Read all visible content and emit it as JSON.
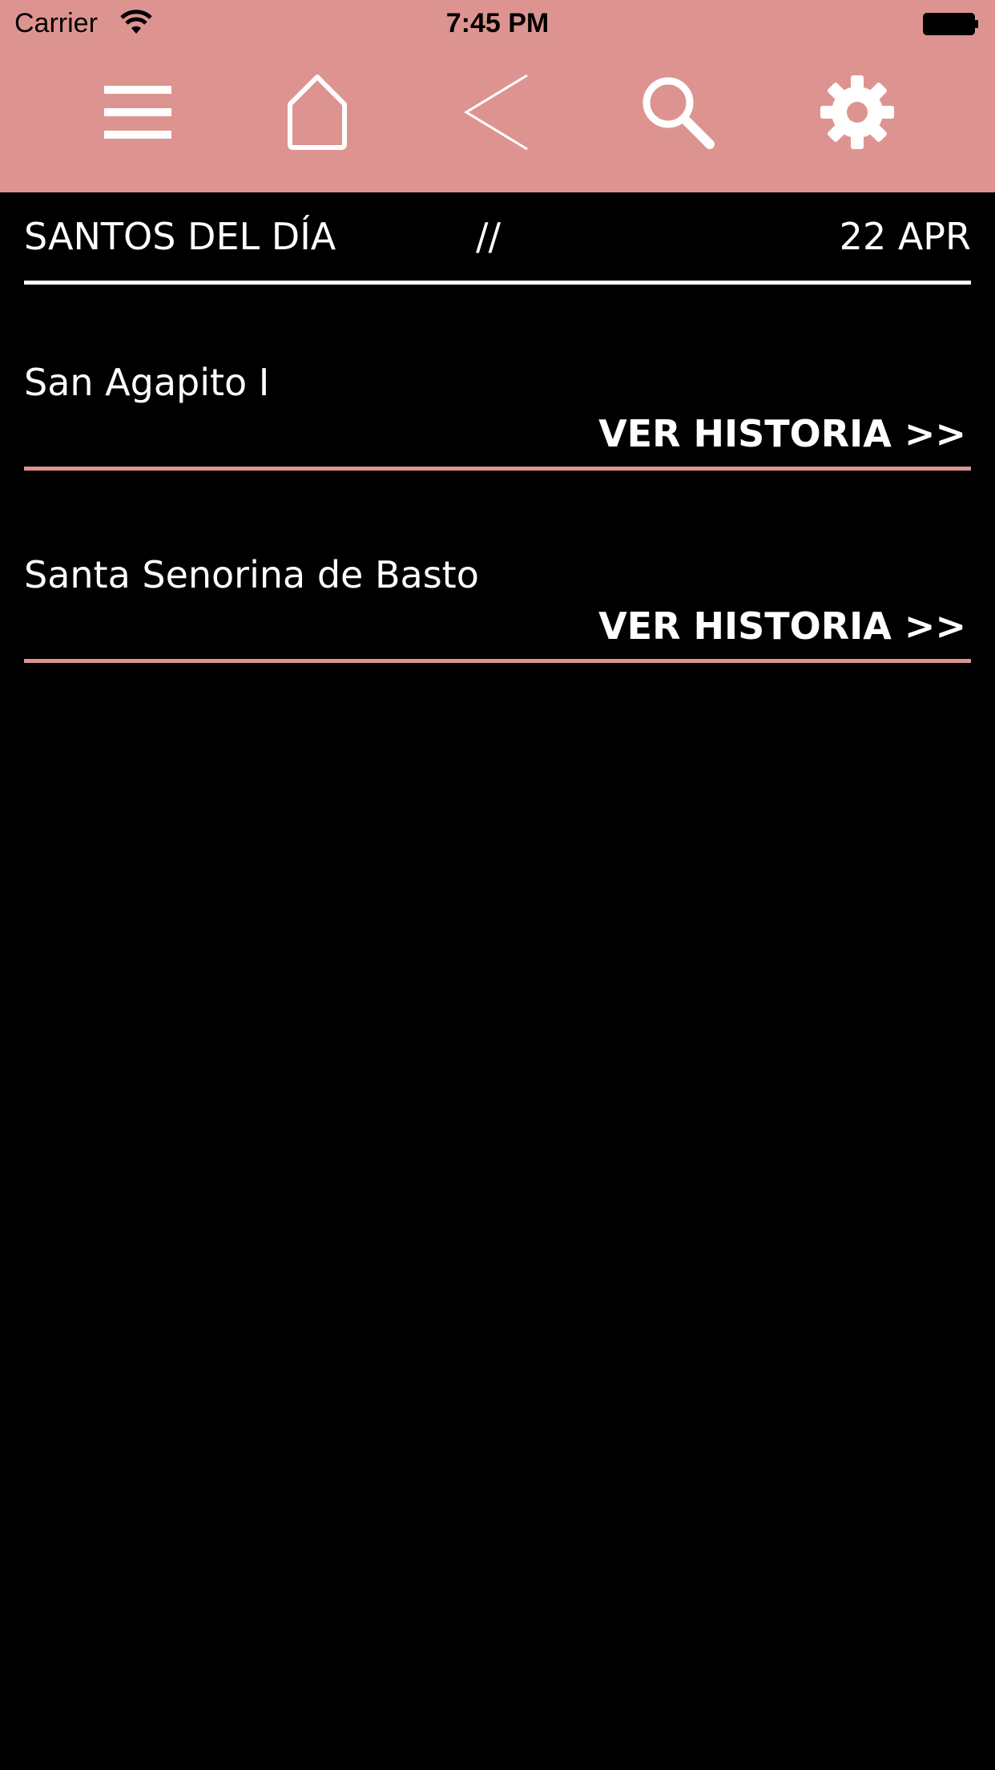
{
  "status_bar": {
    "carrier": "Carrier",
    "time": "7:45 PM"
  },
  "toolbar": {
    "icons": [
      "menu-icon",
      "home-icon",
      "back-icon",
      "search-icon",
      "gear-icon"
    ]
  },
  "header": {
    "title": "SANTOS DEL DÍA",
    "separator": "//",
    "date": "22 APR"
  },
  "saints": [
    {
      "name": "San Agapito I",
      "link_label": "VER HISTORIA >>"
    },
    {
      "name": "Santa Senorina de Basto",
      "link_label": "VER HISTORIA >>"
    }
  ],
  "colors": {
    "accent": "#dd9490",
    "background": "#000000",
    "text": "#ffffff"
  }
}
